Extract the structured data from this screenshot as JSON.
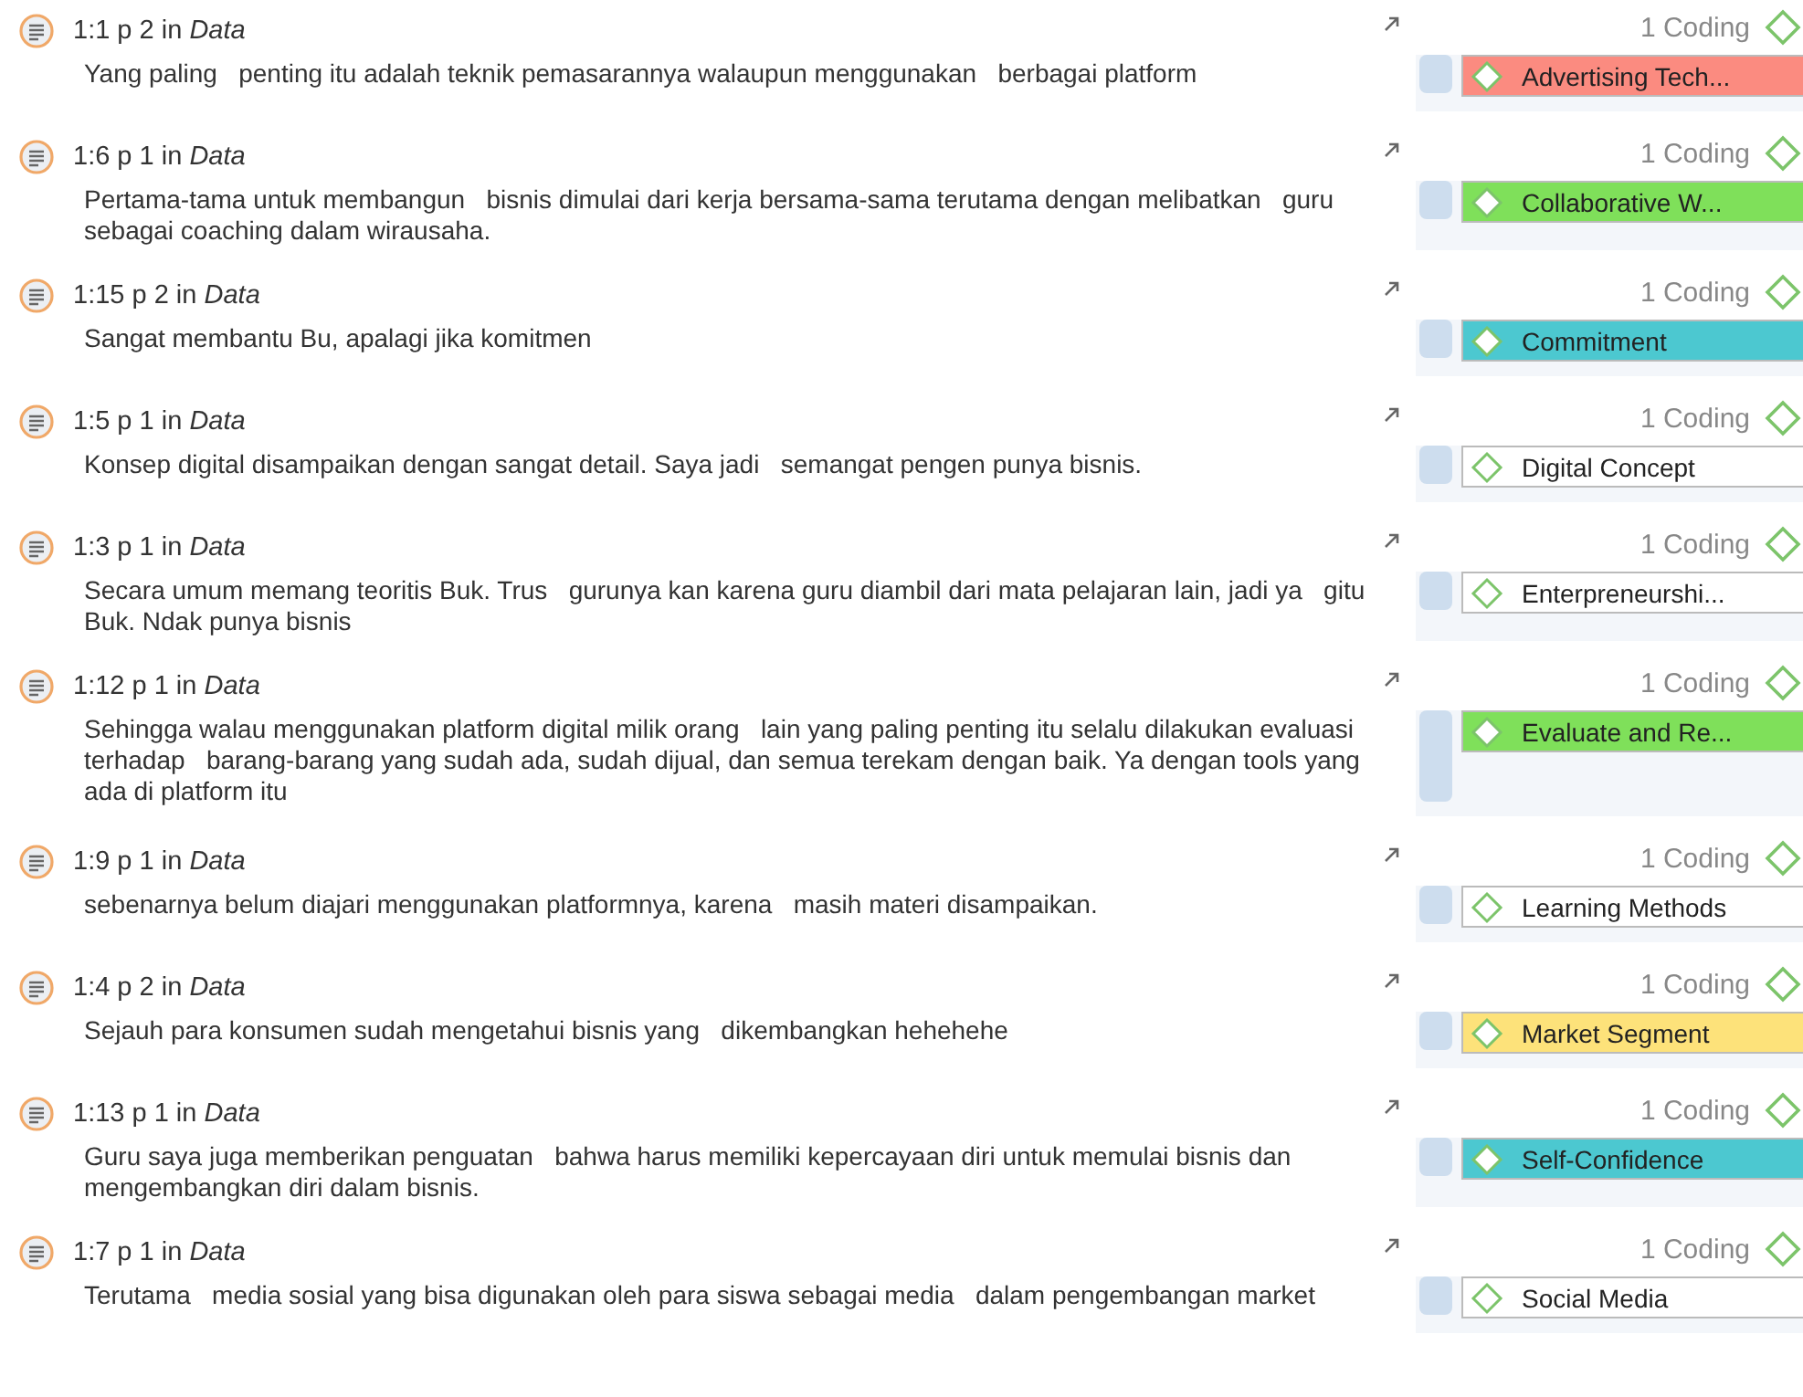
{
  "quotations": [
    {
      "reference": "1:1 p 2 in *Data*",
      "text": "Yang paling   penting itu adalah teknik pemasarannya walaupun menggunakan   berbagai platform",
      "coding_count": "1 Coding",
      "code": {
        "label": "Advertising Tech...",
        "color": "#fb8b80"
      }
    },
    {
      "reference": "1:6 p 1 in *Data*",
      "text": "Pertama-tama untuk membangun   bisnis dimulai dari kerja bersama-sama terutama dengan melibatkan   guru sebagai coaching dalam wirausaha.",
      "coding_count": "1 Coding",
      "code": {
        "label": "Collaborative W...",
        "color": "#7fe05a"
      }
    },
    {
      "reference": "1:15 p 2 in *Data*",
      "text": "Sangat membantu Bu, apalagi jika komitmen",
      "coding_count": "1 Coding",
      "code": {
        "label": "Commitment",
        "color": "#4cc8d0"
      }
    },
    {
      "reference": "1:5 p 1 in *Data*",
      "text": "Konsep digital disampaikan dengan sangat detail. Saya jadi   semangat pengen punya bisnis.",
      "coding_count": "1 Coding",
      "code": {
        "label": "Digital Concept",
        "color": "#ffffff"
      }
    },
    {
      "reference": "1:3 p 1 in *Data*",
      "text": "Secara umum memang teoritis Buk. Trus   gurunya kan karena guru diambil dari mata pelajaran lain, jadi ya   gitu Buk. Ndak punya bisnis",
      "coding_count": "1 Coding",
      "code": {
        "label": "Enterpreneurshi...",
        "color": "#ffffff"
      }
    },
    {
      "reference": "1:12 p 1 in *Data*",
      "text": "Sehingga walau menggunakan platform digital milik orang   lain yang paling penting itu selalu dilakukan evaluasi terhadap   barang-barang yang sudah ada, sudah dijual, dan semua terekam dengan baik. Ya dengan tools yang ada di platform itu",
      "coding_count": "1 Coding",
      "code": {
        "label": "Evaluate and Re...",
        "color": "#7fe05a"
      }
    },
    {
      "reference": "1:9 p 1 in *Data*",
      "text": "sebenarnya belum diajari menggunakan platformnya, karena   masih materi disampaikan.",
      "coding_count": "1 Coding",
      "code": {
        "label": "Learning Methods",
        "color": "#ffffff"
      }
    },
    {
      "reference": "1:4 p 2 in *Data*",
      "text": "Sejauh para konsumen sudah mengetahui bisnis yang   dikembangkan hehehehe",
      "coding_count": "1 Coding",
      "code": {
        "label": "Market Segment",
        "color": "#fde27a"
      }
    },
    {
      "reference": "1:13 p 1 in *Data*",
      "text": "Guru saya juga memberikan penguatan   bahwa harus memiliki kepercayaan diri untuk memulai bisnis dan   mengembangkan diri dalam bisnis.",
      "coding_count": "1 Coding",
      "code": {
        "label": "Self-Confidence",
        "color": "#4cc8d0"
      }
    },
    {
      "reference": "1:7 p 1 in *Data*",
      "text": "Terutama   media sosial yang bisa digunakan oleh para siswa sebagai media   dalam pengembangan market",
      "coding_count": "1 Coding",
      "code": {
        "label": "Social Media",
        "color": "#ffffff"
      }
    }
  ]
}
